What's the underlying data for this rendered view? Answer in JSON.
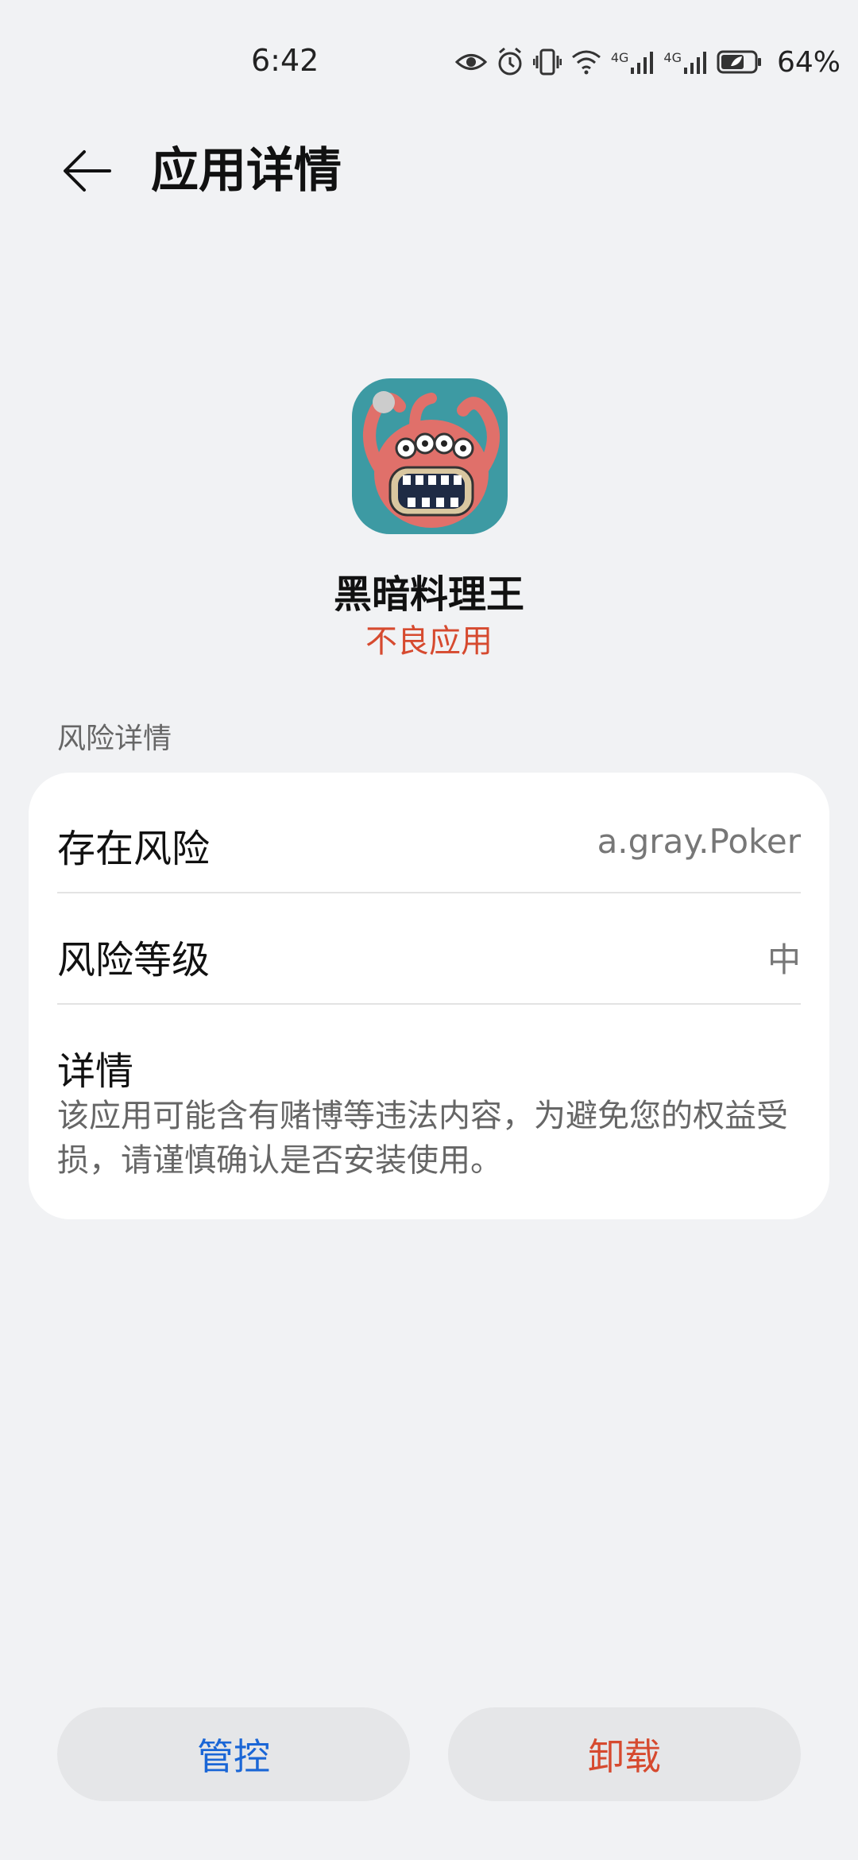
{
  "status_bar": {
    "time": "6:42",
    "battery_percent": "64%",
    "network_1": "4G",
    "network_2": "4G",
    "icons": [
      "eye-icon",
      "alarm-icon",
      "vibrate-icon",
      "wifi-icon",
      "signal-icon",
      "signal-icon",
      "battery-icon"
    ]
  },
  "header": {
    "title": "应用详情",
    "back_icon": "back-arrow-icon"
  },
  "app": {
    "name": "黑暗料理王",
    "status": "不良应用",
    "icon": "app-icon"
  },
  "risk_section": {
    "label": "风险详情",
    "rows": [
      {
        "label": "存在风险",
        "value": "a.gray.Poker"
      },
      {
        "label": "风险等级",
        "value": "中"
      }
    ],
    "detail_label": "详情",
    "detail_text": "该应用可能含有赌博等违法内容，为避免您的权益受损，请谨慎确认是否安装使用。"
  },
  "buttons": {
    "control": "管控",
    "uninstall": "卸载"
  },
  "colors": {
    "background": "#f1f2f4",
    "warning_red": "#d64a2f",
    "link_blue": "#1a66d6"
  }
}
